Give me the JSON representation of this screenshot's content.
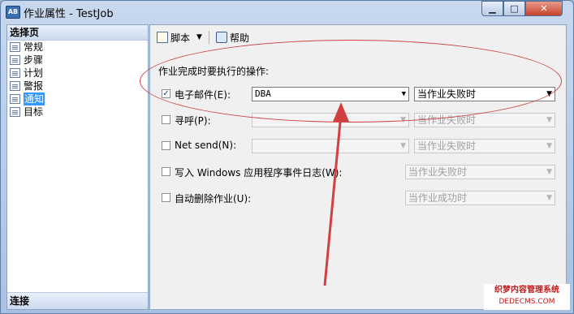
{
  "window": {
    "title": "作业属性 - TestJob",
    "app_icon_text": "AB",
    "min_label": "▁",
    "max_label": "□",
    "close_label": "✕"
  },
  "sidebar": {
    "header": "选择页",
    "items": [
      {
        "label": "常规"
      },
      {
        "label": "步骤"
      },
      {
        "label": "计划"
      },
      {
        "label": "警报"
      },
      {
        "label": "通知",
        "selected": true
      },
      {
        "label": "目标"
      }
    ],
    "bottom_header": "连接"
  },
  "toolbar": {
    "script_label": "脚本",
    "script_dropdown_icon": "▼",
    "help_label": "帮助"
  },
  "notify": {
    "section_label": "作业完成时要执行的操作:",
    "rows": [
      {
        "label": "电子邮件(E):",
        "checked": true,
        "target_value": "DBA",
        "condition": "当作业失败时",
        "enabled": true
      },
      {
        "label": "寻呼(P):",
        "checked": false,
        "target_value": "",
        "condition": "当作业失败时",
        "enabled": false
      },
      {
        "label": "Net send(N):",
        "checked": false,
        "target_value": "",
        "condition": "当作业失败时",
        "enabled": false
      },
      {
        "label": "写入 Windows 应用程序事件日志(W):",
        "checked": false,
        "condition": "当作业失败时",
        "enabled": false
      },
      {
        "label": "自动删除作业(U):",
        "checked": false,
        "condition": "当作业成功时",
        "enabled": false
      }
    ],
    "check_mark": "✓",
    "arrow_glyph": "▼"
  },
  "watermark": {
    "line1": "织梦内容管理系统",
    "line2": "DEDECMS.COM"
  },
  "colors": {
    "annotation": "#d04040",
    "selection": "#3399ff"
  }
}
